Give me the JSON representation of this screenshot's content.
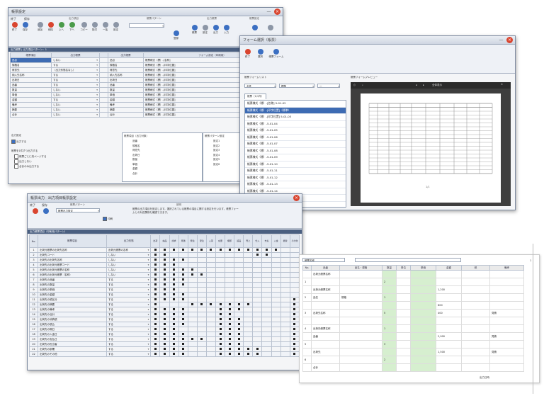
{
  "win1": {
    "title": "帳票設定",
    "ribbon_tabs": [
      "終了",
      "保存"
    ],
    "buttons": [
      "終了",
      "保存",
      "追加",
      "削除",
      "上へ",
      "下へ",
      "コピー",
      "貼付",
      "一括",
      "設定",
      "登録",
      "帳票",
      "設定",
      "出力",
      "入力"
    ],
    "section_labels": [
      "出力項目",
      "帳票パターン",
      "出力帳票",
      "帳票設定"
    ],
    "form_bar": "出力帳票 | 出力項目パターン：1",
    "col_headers": [
      "帳票項目",
      "出力帳票",
      "出力帳票",
      "フォーム設定（印刷用）"
    ],
    "rows": [
      {
        "item": "品目",
        "val": "しない",
        "item2": "品目",
        "form": "帳票様式（標）-[名称]",
        "selected": true
      },
      {
        "item": "規格名",
        "val": "する",
        "item2": "規格名",
        "form": "帳票様式（標）-[印字位置]"
      },
      {
        "item": "得意先",
        "val": "（出力形態名なし）",
        "item2": "得意先",
        "form": "帳票様式（標）-[印字位置]"
      },
      {
        "item": "納入先名称",
        "val": "する",
        "item2": "納入先名称",
        "form": "帳票様式（標）-[印字位置]"
      },
      {
        "item": "出荷日",
        "val": "する",
        "item2": "出荷日",
        "form": "帳票様式（標）-[印字位置]"
      },
      {
        "item": "品番",
        "val": "する",
        "item2": "品番",
        "form": "帳票様式（標）-[印字位置]"
      },
      {
        "item": "数量",
        "val": "しない",
        "item2": "数量",
        "form": "帳票様式（標）-[印字位置]"
      },
      {
        "item": "単価",
        "val": "しない",
        "item2": "単価",
        "form": "帳票様式（標）-[印字位置]"
      },
      {
        "item": "金額",
        "val": "する",
        "item2": "金額",
        "form": "帳票様式（標）-[印字位置]"
      },
      {
        "item": "備考",
        "val": "しない",
        "item2": "備考",
        "form": "帳票様式（標）-[印字位置]"
      },
      {
        "item": "摘要",
        "val": "しない",
        "item2": "摘要",
        "form": "帳票様式（標）-[印字位置]"
      },
      {
        "item": "合計",
        "val": "しない",
        "item2": "合計",
        "form": "帳票様式（標）-[印字位置]"
      }
    ],
    "options_title": "出力設定",
    "options": [
      "出力する",
      "帳票を1件ずつ出力する",
      "帳票ごとに改ページする",
      "出力しない",
      "合計のみ出力する"
    ],
    "list2_title": "帳票項目（出力対象）",
    "list2": [
      "品番",
      "規格名",
      "得意先",
      "出荷日",
      "数量",
      "単価",
      "金額",
      "合計"
    ],
    "list3_title": "帳票パターン設定",
    "list3": [
      "設定1",
      "設定2",
      "設定3",
      "設定4",
      "設定5",
      "設定6"
    ]
  },
  "win2": {
    "title": "フォーム選択（帳票）",
    "buttons": [
      "終了",
      "選択",
      "帳票フォーム"
    ],
    "left_title": "帳票フォームリスト",
    "left_filter": [
      "全件",
      "標準",
      "一"
    ],
    "tab": "帳票（1/1件）",
    "items": [
      "帳票様式（標）-[名称] 5-01-02",
      "帳票様式（標）-[印字位置]（標準）",
      "帳票様式（標）-[印字位置] 5-01-03",
      "帳票様式（標）-5-01-04",
      "帳票様式（標）-5-01-05",
      "帳票様式（標）-5-01-06",
      "帳票様式（標）-5-01-07",
      "帳票様式（標）-5-01-08",
      "帳票様式（標）-5-01-09",
      "帳票様式（標）-5-01-10",
      "帳票様式（標）-5-01-11",
      "帳票様式（標）-5-01-12",
      "帳票様式（標）-5-01-13",
      "帳票様式（標）-5-01-14",
      "帳票様式（標）-5-01-15",
      "帳票様式（標）-5-01-16"
    ],
    "selected_index": 1,
    "right_title": "帳票フォームプレビュー",
    "preview_toolbar": [
      "全体表示"
    ],
    "page_footer": "1/1"
  },
  "win3": {
    "title": "帳票出力　出力項目帳票設定",
    "tabs": [
      "終了",
      "保存"
    ],
    "section_labels": [
      "帳票パターン",
      "説明"
    ],
    "pattern_value": "帳票出力設定",
    "check_label": "印刷",
    "desc": "帳票の出力項目を設定します。選択されている帳票の項目に関する設定を行います。帳票フォームとの対応関係も確認できます。",
    "bar": "出力帳票項目（印刷用パターン）",
    "col_no": "No.",
    "col_item": "帳票項目",
    "col_form": "出力形態",
    "col_checks": [
      "出荷",
      "納品",
      "請求",
      "見積",
      "発注",
      "受注",
      "入荷",
      "在庫",
      "棚卸",
      "返品",
      "売上",
      "仕入",
      "支払",
      "入金",
      "振替",
      "その他"
    ],
    "rows": [
      {
        "no": "1",
        "name": "出荷元帳票の出荷先名称",
        "val": "出荷元帳票の名称"
      },
      {
        "no": "2",
        "name": "出荷先コード",
        "val": "しない"
      },
      {
        "no": "3",
        "name": "出荷先の出荷先名称",
        "val": "しない"
      },
      {
        "no": "4",
        "name": "出荷先の出荷元帳票コード",
        "val": "しない"
      },
      {
        "no": "5",
        "name": "出荷先の出荷元帳票の名称",
        "val": "しない"
      },
      {
        "no": "6",
        "name": "出荷先の出荷元帳票（名称）",
        "val": "しない"
      },
      {
        "no": "7",
        "name": "出荷先の品番",
        "val": "する"
      },
      {
        "no": "8",
        "name": "出荷先の数量",
        "val": "する"
      },
      {
        "no": "9",
        "name": "出荷先の単価",
        "val": "する"
      },
      {
        "no": "10",
        "name": "出荷先の金額",
        "val": "する"
      },
      {
        "no": "11",
        "name": "出荷先の税区分",
        "val": "する"
      },
      {
        "no": "12",
        "name": "出荷先の摘要",
        "val": "する"
      },
      {
        "no": "13",
        "name": "出荷先の備考",
        "val": "する"
      },
      {
        "no": "14",
        "name": "出荷先の合計",
        "val": "する"
      },
      {
        "no": "15",
        "name": "出荷先の消費税",
        "val": "する"
      },
      {
        "no": "16",
        "name": "出荷先の税込",
        "val": "する"
      },
      {
        "no": "17",
        "name": "出荷先の期日",
        "val": "する"
      },
      {
        "no": "18",
        "name": "出荷先の入金日",
        "val": "する"
      },
      {
        "no": "19",
        "name": "出荷先の支払日",
        "val": "する"
      },
      {
        "no": "20",
        "name": "出荷先の担当者",
        "val": "する"
      },
      {
        "no": "21",
        "name": "出荷先の部署",
        "val": "する"
      },
      {
        "no": "22",
        "name": "出荷先のその他",
        "val": "する"
      }
    ]
  },
  "report": {
    "title_field": "帳票名称",
    "page": "1",
    "headers": [
      "No.",
      "品番",
      "品名・規格",
      "数量",
      "単位",
      "単価",
      "金額",
      "税",
      "備考"
    ],
    "rows": [
      {
        "a": "",
        "b": "出荷元帳票名称",
        "c": "",
        "n": "",
        "amt": "",
        "note": ""
      },
      {
        "a": "1",
        "b": "",
        "c": "",
        "n": "2",
        "amt": "",
        "note": ""
      },
      {
        "a": "",
        "b": "出荷元帳票名称",
        "c": "",
        "n": "",
        "amt": "1,200",
        "note": ""
      },
      {
        "a": "2",
        "b": "品名",
        "c": "規格",
        "n": "1",
        "amt": "",
        "note": ""
      },
      {
        "a": "",
        "b": "",
        "c": "",
        "n": "",
        "amt": "600",
        "note": ""
      },
      {
        "a": "3",
        "b": "出荷先名称",
        "c": "",
        "n": "5",
        "amt": "400",
        "note": "見積"
      },
      {
        "a": "",
        "b": "",
        "c": "",
        "n": "",
        "amt": "",
        "note": ""
      },
      {
        "a": "4",
        "b": "出荷先帳票名称",
        "c": "",
        "n": "1",
        "amt": "",
        "note": ""
      },
      {
        "a": "",
        "b": "品番",
        "c": "",
        "n": "",
        "amt": "2,000",
        "note": "見積"
      },
      {
        "a": "5",
        "b": "",
        "c": "",
        "n": "3",
        "amt": "",
        "note": ""
      },
      {
        "a": "",
        "b": "出荷先",
        "c": "",
        "n": "",
        "amt": "1,500",
        "note": "見積"
      },
      {
        "a": "6",
        "b": "",
        "c": "",
        "n": "2",
        "amt": "",
        "note": ""
      },
      {
        "a": "",
        "b": "合計",
        "c": "",
        "n": "",
        "amt": "",
        "note": ""
      }
    ],
    "footer": "出力日時"
  }
}
